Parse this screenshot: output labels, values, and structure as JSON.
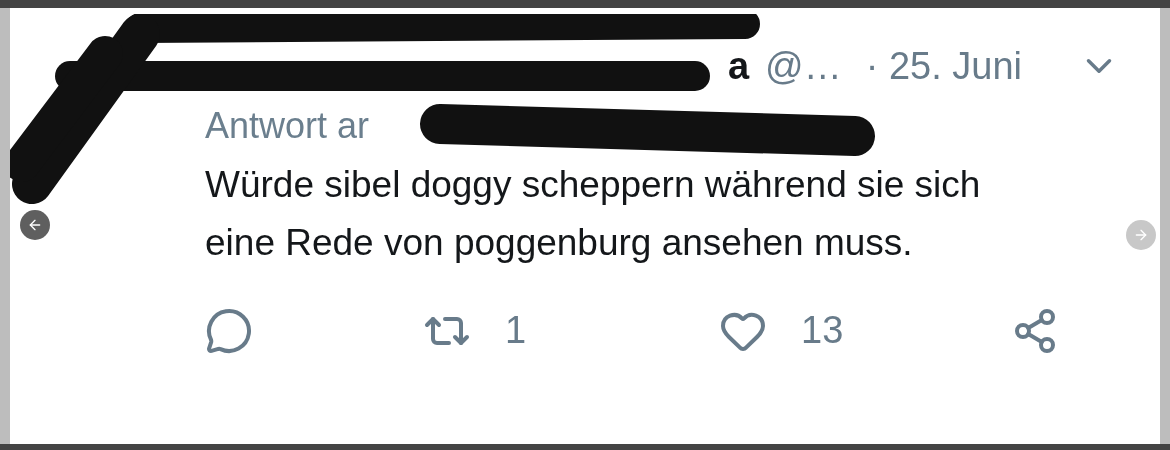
{
  "tweet": {
    "author_visible": "a",
    "handle": "@…",
    "date": "· 25. Juni",
    "reply_to": "Antwort ar",
    "text": "Würde sibel doggy scheppern während sie sich eine Rede von poggenburg ansehen muss.",
    "actions": [
      {
        "kind": "reply"
      },
      {
        "kind": "retweet",
        "count": "1"
      },
      {
        "kind": "like",
        "count": "13"
      },
      {
        "kind": "share"
      }
    ]
  }
}
